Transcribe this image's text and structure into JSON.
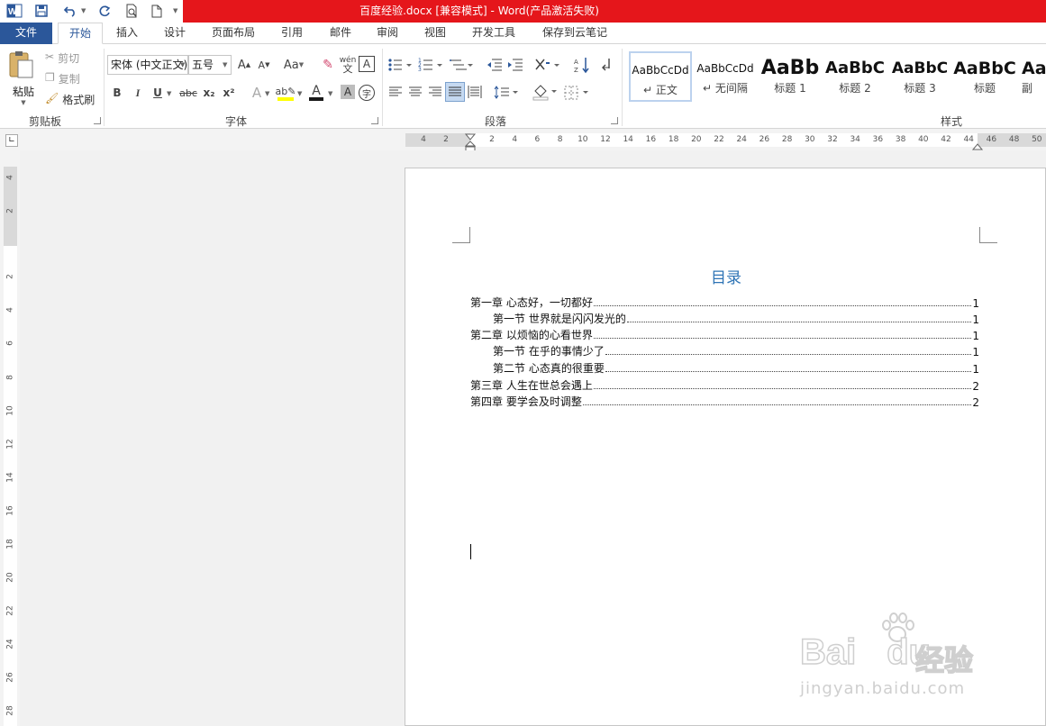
{
  "titlebar": {
    "title": "百度经验.docx [兼容模式] - Word(产品激活失败)"
  },
  "quick_access": {
    "word_icon": "W",
    "save_icon": "save-icon",
    "undo_icon": "undo-icon",
    "redo_icon": "redo-icon",
    "preview_icon": "print-preview-icon",
    "new_icon": "new-document-icon"
  },
  "tabs": {
    "file": "文件",
    "items": [
      "开始",
      "插入",
      "设计",
      "页面布局",
      "引用",
      "邮件",
      "审阅",
      "视图",
      "开发工具",
      "保存到云笔记"
    ]
  },
  "clipboard": {
    "paste": "粘贴",
    "cut": "剪切",
    "copy": "复制",
    "format_painter": "格式刷",
    "label": "剪贴板"
  },
  "font": {
    "name": "宋体 (中文正文)",
    "size": "五号",
    "label": "字体",
    "grow": "A",
    "shrink": "A",
    "case": "Aa",
    "bold": "B",
    "italic": "I",
    "underline": "U",
    "strike": "abc",
    "sub": "x₂",
    "sup": "x²",
    "effect": "A",
    "color": "A",
    "shade": "A",
    "phonetic": "wén",
    "border_char": "A",
    "enclose": "字"
  },
  "paragraph": {
    "label": "段落"
  },
  "styles": {
    "label": "样式",
    "items": [
      {
        "sample": "AaBbCcDd",
        "name": "正文",
        "selected": true
      },
      {
        "sample": "AaBbCcDd",
        "name": "无间隔"
      },
      {
        "sample": "AaBb",
        "name": "标题 1"
      },
      {
        "sample": "AaBbC",
        "name": "标题 2"
      },
      {
        "sample": "AaBbC",
        "name": "标题 3"
      },
      {
        "sample": "AaBbC",
        "name": "标题"
      },
      {
        "sample": "Aa",
        "name": "副"
      }
    ]
  },
  "ruler": {
    "h_left": [
      "4",
      "2"
    ],
    "h_right": [
      "2",
      "4",
      "6",
      "8",
      "10",
      "12",
      "14",
      "16",
      "18",
      "20",
      "22",
      "24",
      "26",
      "28",
      "30",
      "32",
      "34",
      "36",
      "38",
      "40",
      "42",
      "44",
      "46",
      "48",
      "50"
    ],
    "v": [
      "4",
      "2",
      "2",
      "4",
      "6",
      "8",
      "10",
      "12",
      "14",
      "16",
      "18",
      "20",
      "22",
      "24",
      "26",
      "28"
    ]
  },
  "document": {
    "toc_title": "目录",
    "toc": [
      {
        "text": "第一章  心态好，一切都好",
        "page": "1",
        "level": 1
      },
      {
        "text": "第一节  世界就是闪闪发光的",
        "page": "1",
        "level": 2
      },
      {
        "text": "第二章  以烦恼的心看世界",
        "page": "1",
        "level": 1
      },
      {
        "text": "第一节  在乎的事情少了",
        "page": "1",
        "level": 2
      },
      {
        "text": "第二节  心态真的很重要",
        "page": "1",
        "level": 2
      },
      {
        "text": "第三章  人生在世总会遇上",
        "page": "2",
        "level": 1
      },
      {
        "text": "第四章  要学会及时调整",
        "page": "2",
        "level": 1
      }
    ]
  },
  "watermark": {
    "brand_left": "Bai",
    "brand_right": "du",
    "jingyan": "经验",
    "url": "jingyan.baidu.com"
  }
}
